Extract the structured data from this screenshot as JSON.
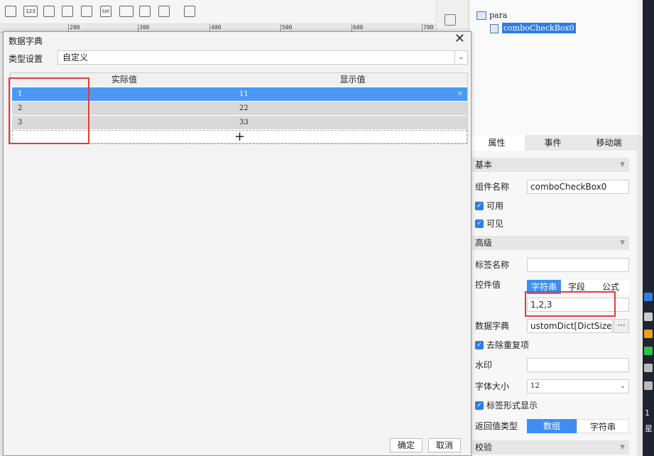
{
  "toolbar": {
    "icons": [
      "calendar-icon",
      "number-icon",
      "textarea-icon",
      "radio-group-icon",
      "checkbox-group-icon",
      "text-icon",
      "password-icon",
      "combo-checkbox-icon",
      "tree-icon",
      "more-icon"
    ],
    "number_icon_text": "123",
    "text_icon_text": "txt"
  },
  "ruler": {
    "ticks": [
      "200",
      "300",
      "400",
      "500",
      "600",
      "700"
    ]
  },
  "tree": {
    "root": "para",
    "child": "comboCheckBox0"
  },
  "props_tabs": [
    "属性",
    "事件",
    "移动端"
  ],
  "props": {
    "section_basic": "基本",
    "name_label": "组件名称",
    "name_value": "comboCheckBox0",
    "enabled_label": "可用",
    "visible_label": "可见",
    "section_advanced": "高级",
    "tag_name_label": "标签名称",
    "tag_name_value": "",
    "control_value_label": "控件值",
    "control_value_types": [
      "字符串",
      "字段",
      "公式"
    ],
    "control_value": "1,2,3",
    "dict_label": "数据字典",
    "dict_value": "ustomDict[DictSize:3]",
    "dict_more": "···",
    "dedup_label": "去除重复项",
    "watermark_label": "水印",
    "watermark_value": "",
    "font_size_label": "字体大小",
    "font_size_value": "12",
    "tag_display_label": "标签形式显示",
    "return_type_label": "返回值类型",
    "return_types": [
      "数组",
      "字符串"
    ],
    "section_validate": "校验"
  },
  "dialog": {
    "title": "数据字典",
    "type_label": "类型设置",
    "type_value": "自定义",
    "columns": [
      "实际值",
      "显示值"
    ],
    "rows": [
      {
        "actual": "1",
        "display": "11"
      },
      {
        "actual": "2",
        "display": "22"
      },
      {
        "actual": "3",
        "display": "33"
      }
    ],
    "delete_glyph": "✕",
    "add_glyph": "+",
    "ok_label": "确定",
    "cancel_label": "取消"
  },
  "tray": {
    "time_a": "1",
    "time_b": "星"
  },
  "colors": {
    "accent": "#3d8ef0",
    "selected_row": "#4a9af4",
    "row_bg": "#d9d9d9",
    "highlight_box": "#e23b3b"
  }
}
